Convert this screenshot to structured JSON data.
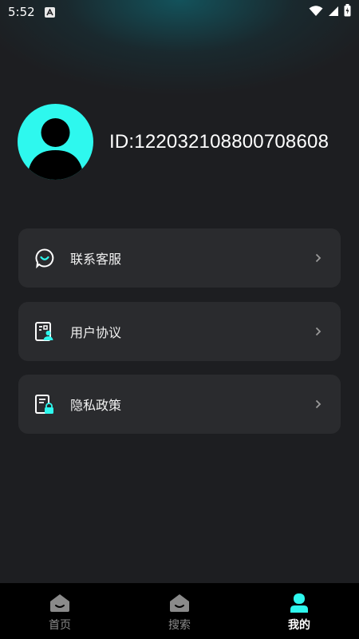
{
  "status_bar": {
    "time": "5:52"
  },
  "profile": {
    "id_text": "ID:122032108800708608"
  },
  "menu": {
    "items": [
      {
        "label": "联系客服",
        "icon": "customer-service-icon"
      },
      {
        "label": "用户协议",
        "icon": "user-agreement-icon"
      },
      {
        "label": "隐私政策",
        "icon": "privacy-policy-icon"
      }
    ]
  },
  "bottom_nav": {
    "items": [
      {
        "label": "首页",
        "icon": "home-icon",
        "active": false
      },
      {
        "label": "搜索",
        "icon": "search-home-icon",
        "active": false
      },
      {
        "label": "我的",
        "icon": "profile-icon",
        "active": true
      }
    ]
  },
  "colors": {
    "accent": "#2ef8ee",
    "background": "#1d1e21",
    "card": "#2a2b2e",
    "nav_background": "#000000"
  }
}
